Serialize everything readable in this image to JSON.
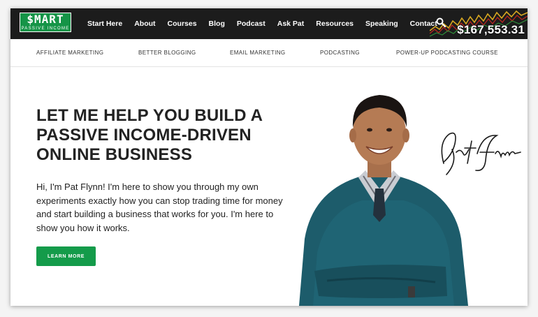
{
  "brand": {
    "logo_main": "$MART",
    "logo_sub": "PASSIVE INCOME"
  },
  "nav": {
    "items": [
      {
        "label": "Start Here"
      },
      {
        "label": "About"
      },
      {
        "label": "Courses"
      },
      {
        "label": "Blog"
      },
      {
        "label": "Podcast"
      },
      {
        "label": "Ask Pat"
      },
      {
        "label": "Resources"
      },
      {
        "label": "Speaking"
      },
      {
        "label": "Contact"
      }
    ],
    "search_icon": "search-icon",
    "income": "$167,553.31"
  },
  "subnav": {
    "items": [
      {
        "label": "AFFILIATE MARKETING"
      },
      {
        "label": "BETTER BLOGGING"
      },
      {
        "label": "EMAIL MARKETING"
      },
      {
        "label": "PODCASTING"
      },
      {
        "label": "POWER-UP PODCASTING COURSE"
      }
    ]
  },
  "hero": {
    "title": "LET ME HELP YOU BUILD A PASSIVE INCOME-DRIVEN ONLINE BUSINESS",
    "text": "Hi, I'm Pat Flynn! I'm here to show you through my own experiments exactly how you can stop trading time for money and start building a business that works for you. I'm here to show you how it works.",
    "button": "LEARN MORE"
  },
  "colors": {
    "brand_green": "#159447",
    "topbar": "#1c1c1c",
    "text": "#222222"
  }
}
